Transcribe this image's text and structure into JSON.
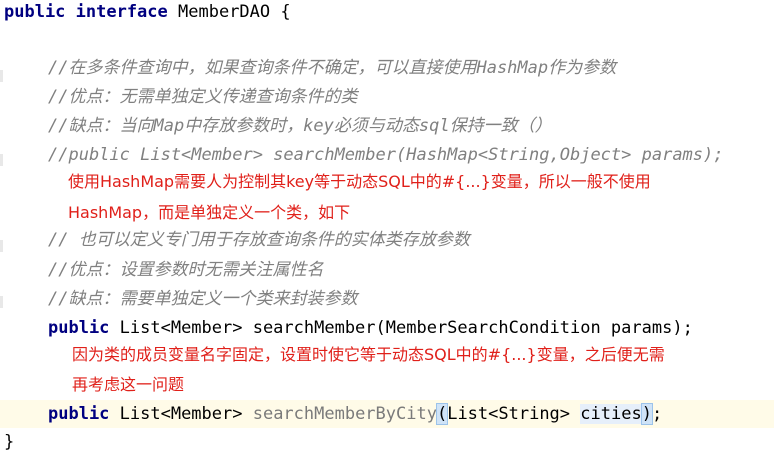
{
  "code": {
    "interface_kw": "public interface",
    "interface_name": "MemberDAO {",
    "comments": [
      "//在多条件查询中，如果查询条件不确定，可以直接使用HashMap作为参数",
      "//优点：无需单独定义传递查询条件的类",
      "//缺点：当向Map中存放参数时，key必须与动态sql保持一致（）",
      "//public List<Member> searchMember(HashMap<String,Object> params);"
    ],
    "comments2": [
      "// 也可以定义专门用于存放查询条件的实体类存放参数",
      "//优点：设置参数时无需关注属性名",
      "//缺点：需要单独定义一个类来封装参数"
    ],
    "method1": {
      "kw": "public",
      "rest": " List<Member> searchMember(MemberSearchCondition params);"
    },
    "method2": {
      "kw": "public",
      "type": " List<Member> ",
      "name": "searchMemberByCity",
      "paren_open": "(",
      "params": "List<String> ",
      "arg": "cities",
      "paren_close": ")",
      "end": ";"
    },
    "closing": "}"
  },
  "notes": {
    "note1_line1": "使用HashMap需要人为控制其key等于动态SQL中的#{...}变量，所以一般不使用",
    "note1_line2": "HashMap，而是单独定义一个类，如下",
    "note2_line1": "因为类的成员变量名字固定，设置时使它等于动态SQL中的#{...}变量，之后便无需",
    "note2_line2": "再考虑这一问题"
  },
  "colors": {
    "keyword": "#000080",
    "comment": "#808080",
    "annotation_red": "#e0201a",
    "current_line": "#fffbe8"
  }
}
